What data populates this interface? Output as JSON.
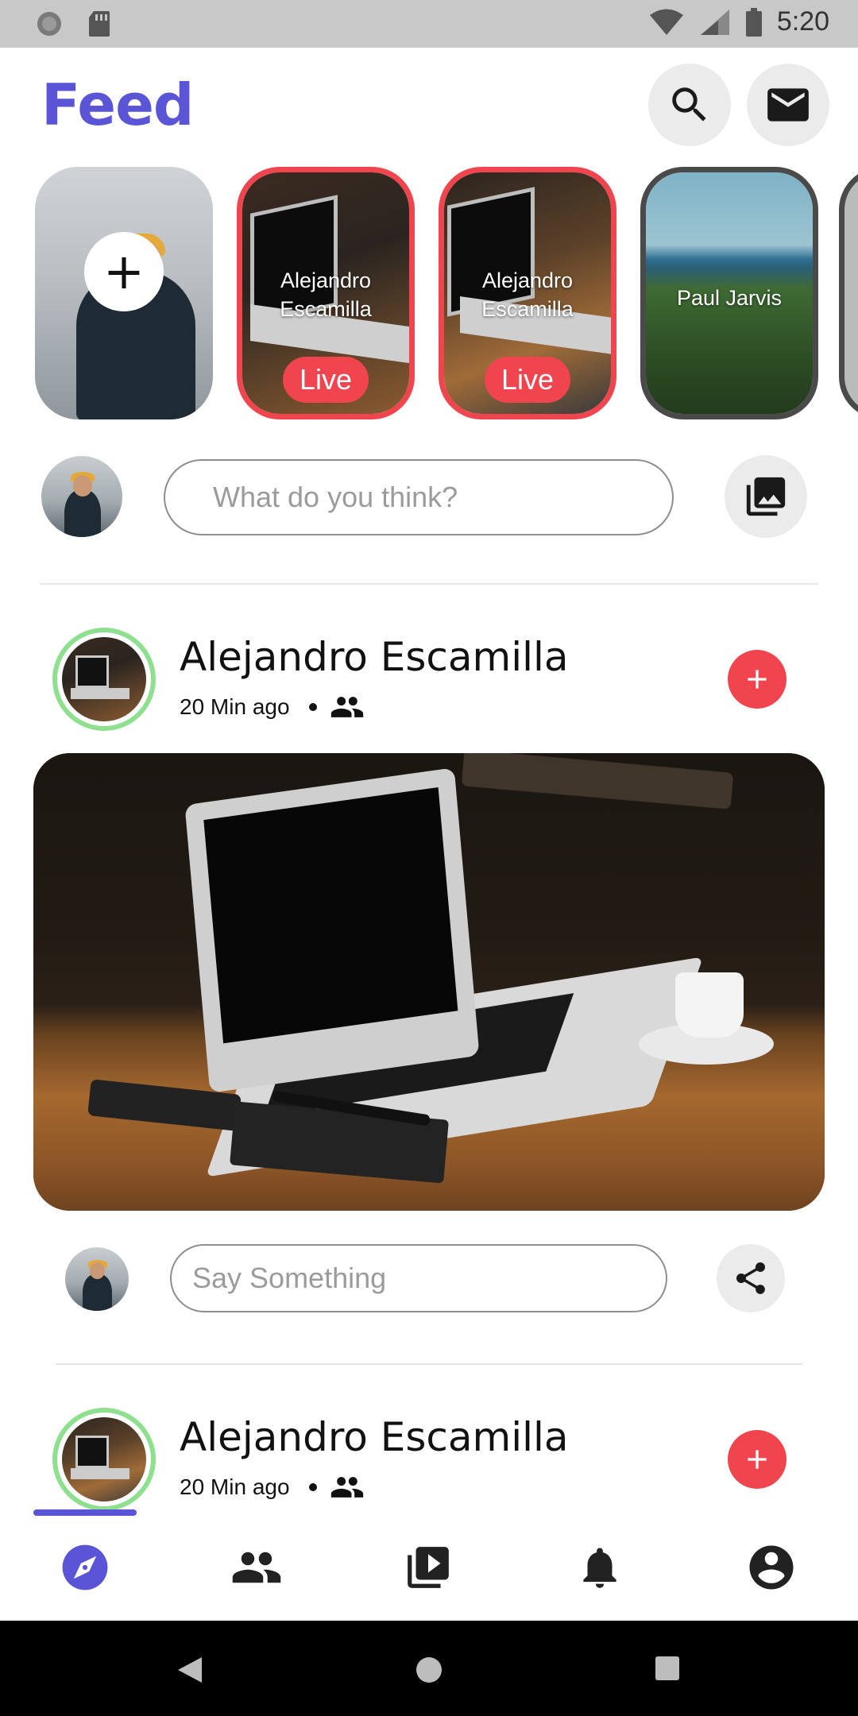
{
  "status_bar": {
    "time": "5:20"
  },
  "header": {
    "title": "Feed"
  },
  "colors": {
    "accent": "#5a55d6",
    "live": "#f0454f",
    "online_ring": "#8ee08f"
  },
  "stories": [
    {
      "type": "add",
      "name": ""
    },
    {
      "type": "live",
      "name": "Alejandro Escamilla",
      "badge": "Live"
    },
    {
      "type": "live",
      "name": "Alejandro Escamilla",
      "badge": "Live"
    },
    {
      "type": "normal",
      "name": "Paul Jarvis"
    }
  ],
  "composer": {
    "placeholder": "What do you think?",
    "icon": "photo-library-icon"
  },
  "posts": [
    {
      "author": "Alejandro Escamilla",
      "time": "20 Min ago",
      "audience_icon": "people-icon",
      "comment_placeholder": "Say Something",
      "share_icon": "share-icon"
    },
    {
      "author": "Alejandro Escamilla",
      "time": "20 Min ago",
      "audience_icon": "people-icon"
    }
  ],
  "bottom_nav": [
    {
      "name": "explore",
      "icon": "compass-icon",
      "active": true
    },
    {
      "name": "friends",
      "icon": "people-icon",
      "active": false
    },
    {
      "name": "videos",
      "icon": "video-library-icon",
      "active": false
    },
    {
      "name": "notifications",
      "icon": "bell-icon",
      "active": false
    },
    {
      "name": "profile",
      "icon": "account-circle-icon",
      "active": false
    }
  ]
}
